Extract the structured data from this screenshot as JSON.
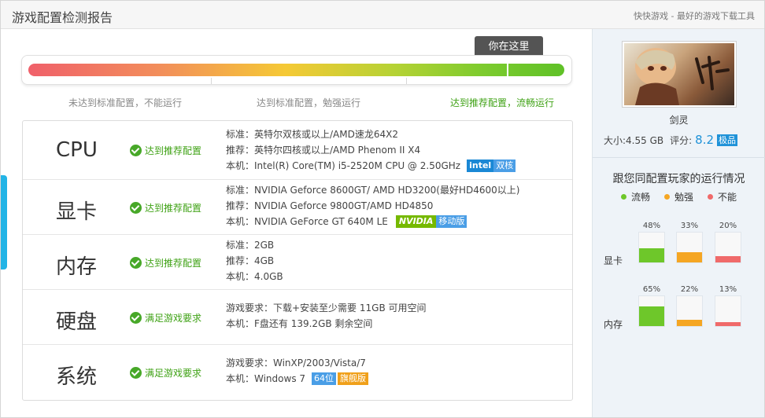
{
  "header": {
    "title": "游戏配置检测报告",
    "tagline": "快快游戏 - 最好的游戏下载工具"
  },
  "progress": {
    "marker_label": "你在这里",
    "levels": [
      {
        "label": "未达到标准配置，不能运行",
        "color": "#888888"
      },
      {
        "label": "达到标准配置，勉强运行",
        "color": "#888888"
      },
      {
        "label": "达到推荐配置，流畅运行",
        "color": "#3fa215"
      }
    ],
    "position_fraction": 0.905
  },
  "specs": {
    "cpu": {
      "name": "CPU",
      "status": "达到推荐配置",
      "standard": "标准：英特尔双核或以上/AMD速龙64X2",
      "recommended": "推荐：英特尔四核或以上/AMD Phenom II X4",
      "local": "本机：Intel(R) Core(TM) i5-2520M CPU @ 2.50GHz",
      "badges": [
        "intel",
        "双核"
      ]
    },
    "gpu": {
      "name": "显卡",
      "status": "达到推荐配置",
      "standard": "标准：NVIDIA Geforce 8600GT/ AMD HD3200(最好HD4600以上)",
      "recommended": "推荐：NVIDIA Geforce 9800GT/AMD HD4850",
      "local": "本机：NVIDIA GeForce GT 640M LE",
      "badges": [
        "NVIDIA",
        "移动版"
      ]
    },
    "ram": {
      "name": "内存",
      "status": "达到推荐配置",
      "standard": "标准：2GB",
      "recommended": "推荐：4GB",
      "local": "本机：4.0GB"
    },
    "disk": {
      "name": "硬盘",
      "status": "满足游戏要求",
      "requirement": "游戏要求：下载+安装至少需要 11GB 可用空间",
      "local": "本机：F盘还有 139.2GB 剩余空间"
    },
    "os": {
      "name": "系统",
      "status": "满足游戏要求",
      "requirement": "游戏要求：WinXP/2003/Vista/7",
      "local": "本机：Windows 7",
      "badges": [
        "64位",
        "旗舰版"
      ]
    }
  },
  "game": {
    "name": "剑灵",
    "size": "大小:4.55 GB",
    "score_label": "评分:",
    "score": "8.2",
    "score_tag": "极品"
  },
  "players": {
    "title": "跟您同配置玩家的运行情况",
    "legend": [
      {
        "label": "流畅",
        "color": "#6ec72a"
      },
      {
        "label": "勉强",
        "color": "#f5a623"
      },
      {
        "label": "不能",
        "color": "#f06a6a"
      }
    ],
    "groups": [
      {
        "label": "显卡",
        "values": [
          "48%",
          "33%",
          "20%"
        ],
        "fractions": [
          0.48,
          0.33,
          0.2
        ]
      },
      {
        "label": "内存",
        "values": [
          "65%",
          "22%",
          "13%"
        ],
        "fractions": [
          0.65,
          0.22,
          0.13
        ]
      }
    ]
  }
}
